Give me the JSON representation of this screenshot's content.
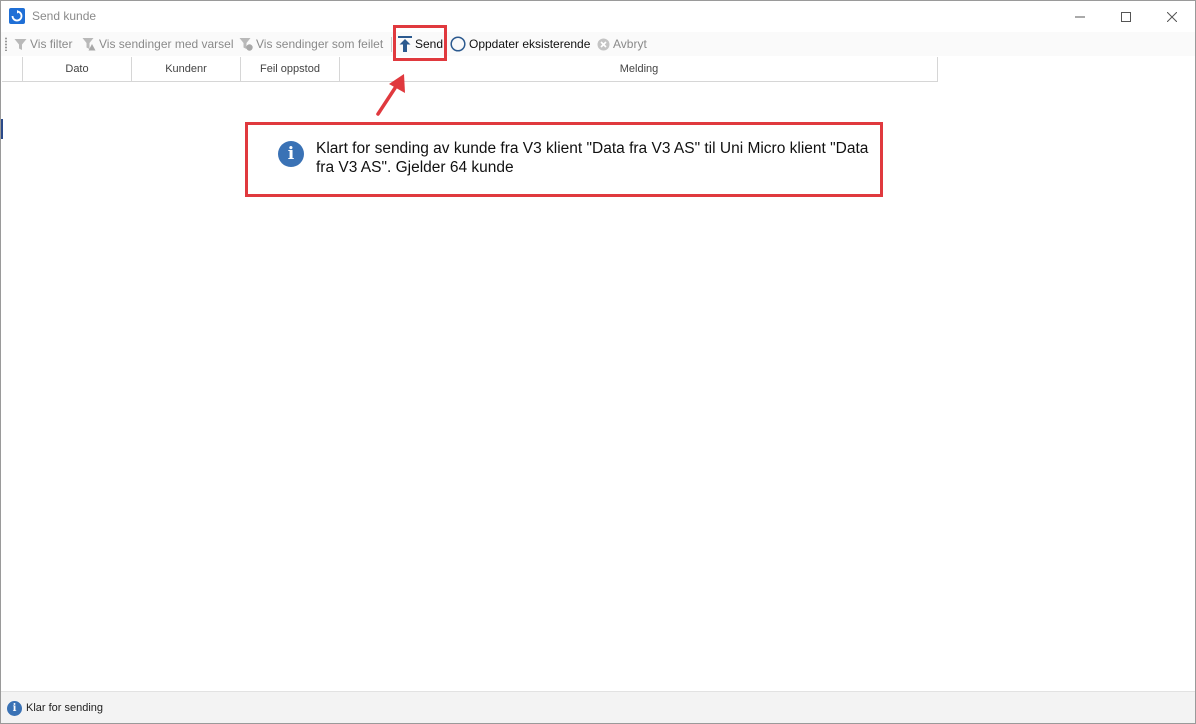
{
  "window": {
    "title": "Send kunde",
    "accent": "#1f6fd6"
  },
  "toolbar": {
    "vis_filter": "Vis filter",
    "vis_med_varsel": "Vis sendinger med varsel",
    "vis_feilet": "Vis sendinger som feilet",
    "send": "Send",
    "oppdater": "Oppdater eksisterende",
    "avbryt": "Avbryt"
  },
  "grid": {
    "columns": [
      "Dato",
      "Kundenr",
      "Feil oppstod",
      "Melding"
    ]
  },
  "info": {
    "message": "Klart for sending av kunde fra V3 klient \"Data fra V3 AS\" til Uni Micro klient \"Data fra V3 AS\". Gjelder 64 kunde",
    "highlight_color": "#e0393e"
  },
  "status": {
    "text": "Klar for sending"
  }
}
